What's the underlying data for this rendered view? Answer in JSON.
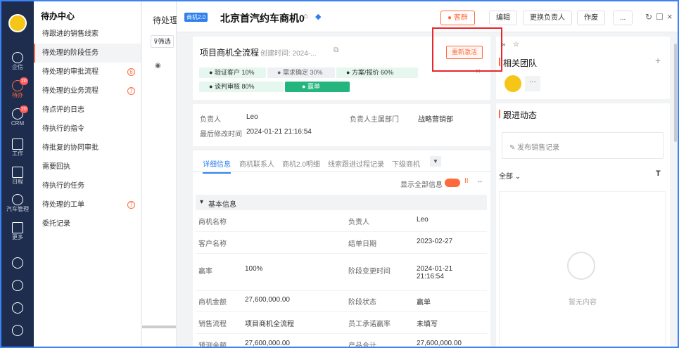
{
  "rail": {
    "items": [
      {
        "label": "企信"
      },
      {
        "label": "待办",
        "badge": "20"
      },
      {
        "label": "CRM",
        "badge": "20"
      },
      {
        "label": "工作"
      },
      {
        "label": "日程"
      },
      {
        "label": "汽车管理"
      },
      {
        "label": "更多"
      }
    ]
  },
  "todo": {
    "title": "待办中心",
    "items": [
      {
        "label": "待跟进的销售线索"
      },
      {
        "label": "待处理的阶段任务"
      },
      {
        "label": "待处理的审批流程",
        "count": "6"
      },
      {
        "label": "待处理的业务流程",
        "count": "7"
      },
      {
        "label": "待点评的日志"
      },
      {
        "label": "待执行的指令"
      },
      {
        "label": "待批复的协同审批"
      },
      {
        "label": "需要回执"
      },
      {
        "label": "待执行的任务"
      },
      {
        "label": "待处理的工单",
        "count": "7"
      },
      {
        "label": "委托记录"
      }
    ]
  },
  "list": {
    "header": "待处理的阶",
    "filter": "筛选"
  },
  "detail": {
    "tag": "商机2.0",
    "title": "北京首汽约车商机0",
    "buttons": {
      "customer": "客群",
      "edit": "编辑",
      "change_owner": "更换负责人",
      "void": "作废",
      "more": "..."
    },
    "process": {
      "title": "项目商机全流程",
      "created": "创建时间: 2024-...",
      "reactivate": "重新激活"
    },
    "stages": [
      {
        "name": "验证客户",
        "pct": "10%"
      },
      {
        "name": "需求确定",
        "pct": "30%"
      },
      {
        "name": "方案/报价",
        "pct": "60%"
      },
      {
        "name": "谈判审核",
        "pct": "80%"
      },
      {
        "name": "赢单",
        "pct": ""
      }
    ],
    "owner": {
      "label": "负责人",
      "value": "Leo"
    },
    "dept": {
      "label": "负责人主属部门",
      "value": "战略营销部"
    },
    "modified": {
      "label": "最后修改时间",
      "value": "2024-01-21 21:16:54"
    },
    "tabs": [
      "详细信息",
      "商机联系人",
      "商机2.0明细",
      "线索跟进过程记录",
      "下级商机"
    ],
    "show_all": "显示全部信息",
    "section": "基本信息",
    "fields": [
      {
        "l1": "商机名称",
        "v1": "",
        "l2": "负责人",
        "v2": "Leo"
      },
      {
        "l1": "客户名称",
        "v1": "",
        "l2": "结单日期",
        "v2": "2023-02-27"
      },
      {
        "l1": "赢率",
        "v1": "100%",
        "l2": "阶段变更时间",
        "v2": "2024-01-21\n21:16:54"
      },
      {
        "l1": "商机金额",
        "v1": "27,600,000.00",
        "l2": "阶段状态",
        "v2": "赢单"
      },
      {
        "l1": "销售流程",
        "v1": "项目商机全流程",
        "l2": "员工承诺赢率",
        "v2": "未填写"
      },
      {
        "l1": "预测金额",
        "v1": "27,600,000.00",
        "l2": "产品合计",
        "v2": "27,600,000.00"
      }
    ]
  },
  "side": {
    "team": "相关团队",
    "follow": "跟进动态",
    "post": "发布销售记录",
    "filter": "全部",
    "empty": "暂无内容"
  },
  "colors": {
    "accent": "#ff6a3d",
    "stage_green": "#24b47e",
    "rail": "#1e2d4d",
    "highlight": "#e8262b"
  }
}
